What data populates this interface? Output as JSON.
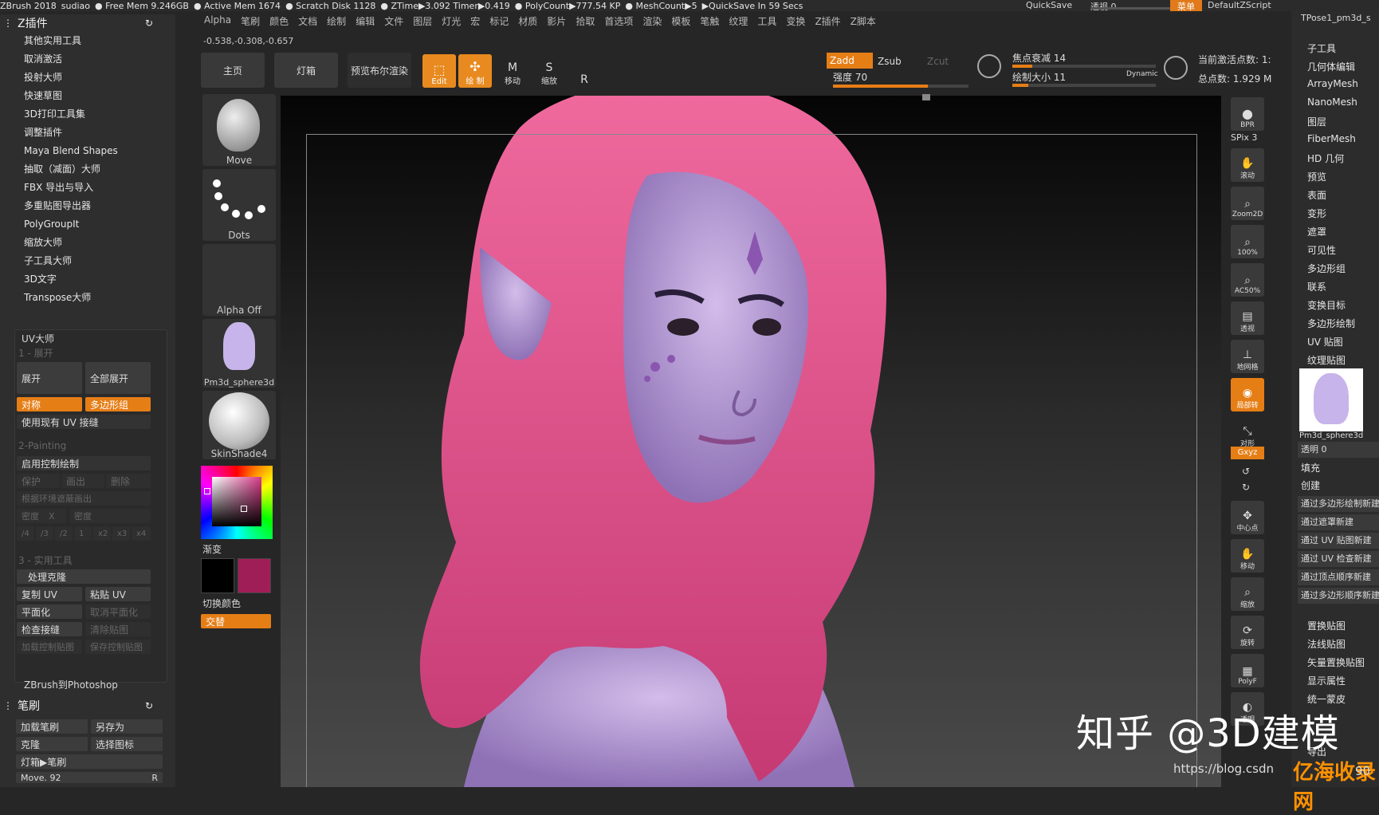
{
  "titlebar": {
    "items": [
      "ZBrush 2018",
      "sudiao",
      "● Free Mem 9.246GB",
      "● Active Mem 1674",
      "● Scratch Disk 1128",
      "● ZTime▶3.092 Timer▶0.419",
      "● PolyCount▶777.54 KP",
      "● MeshCount▶5",
      "▶QuickSave In 59 Secs"
    ],
    "quicksave": "QuickSave",
    "transparency": "透视  0",
    "menu": "菜单",
    "default_script": "DefaultZScript"
  },
  "menubar": [
    "Alpha",
    "笔刷",
    "颜色",
    "文档",
    "绘制",
    "编辑",
    "文件",
    "图层",
    "灯光",
    "宏",
    "标记",
    "材质",
    "影片",
    "拾取",
    "首选项",
    "渲染",
    "模板",
    "笔触",
    "纹理",
    "工具",
    "变换",
    "Z插件",
    "Z脚本"
  ],
  "coords": "-0.538,-0.308,-0.657",
  "left_panel": {
    "title": "Z插件",
    "items": [
      "其他实用工具",
      "取消激活",
      "投射大师",
      "快速草图",
      "3D打印工具集",
      "调整插件",
      "Maya Blend Shapes",
      "抽取（减面）大师",
      "FBX 导出与导入",
      "多重贴图导出器",
      "PolyGroupIt",
      "缩放大师",
      "子工具大师",
      "3D文字",
      "Transpose大师"
    ],
    "uv_master": "UV大师",
    "uv_step1": "1 - 展开",
    "unwrap": "展开",
    "unwrap_all": "全部展开",
    "symmetry": "对称",
    "polygroups": "多边形组",
    "use_existing_seams": "使用现有 UV 接缝",
    "step2": "2-Painting",
    "enable_control_painting": "启用控制绘制",
    "protect": "保护",
    "attract": "画出",
    "erase": "删除",
    "attract_from_ambient": "根据环境遮蔽画出",
    "density": "密度",
    "density_x": "X",
    "density2": "密度",
    "div4": "/4",
    "div3": "/3",
    "div2": "/2",
    "one": "1",
    "x2": "x2",
    "x3": "x3",
    "x4": "x4",
    "step3": "3 - 实用工具",
    "work_on_clone": "处理克隆",
    "copy_uvs": "复制 UV",
    "paste_uvs": "粘贴 UV",
    "flatten": "平面化",
    "unflatten": "取消平面化",
    "check_seams": "检查接缝",
    "clear_maps": "清除贴图",
    "load_control_map": "加载控制贴图",
    "save_control_map": "保存控制贴图",
    "zb_to_ps": "ZBrush到Photoshop",
    "brush_title": "笔刷",
    "load_brush": "加载笔刷",
    "save_as": "另存为",
    "clone": "克隆",
    "select_icon": "选择图标",
    "lightbox_brush": "灯箱▶笔刷",
    "move_value": "Move. 92",
    "r_label": "R"
  },
  "shelf": {
    "home": "主页",
    "lightbox": "灯箱",
    "bpr": "预览布尔渲染",
    "edit": "Edit",
    "draw": "绘 制",
    "move": "移动",
    "scale": "缩放",
    "rotate": "旋转",
    "zadd": "Zadd",
    "zsub": "Zsub",
    "zcut": "Zcut",
    "focal_shift": "焦点衰减 14",
    "draw_size": "绘制大小 11",
    "dynamic": "Dynamic",
    "intensity": "强度 70",
    "active_points": "当前激活点数: 1:",
    "total_points": "总点数: 1.929 M",
    "focal_shift_value": 14,
    "draw_size_value": 11,
    "intensity_value": 70
  },
  "tools": {
    "move": "Move",
    "dots": "Dots",
    "alpha_off": "Alpha Off",
    "pm3d": "Pm3d_sphere3d",
    "skinshade": "SkinShade4",
    "gradient": "渐变",
    "switch_color": "切换颜色",
    "alternate": "交替"
  },
  "rightcol": {
    "bpr": "BPR",
    "spix": "SPix 3",
    "scroll": "滚动",
    "zoom2d": "Zoom2D",
    "pct100": "100%",
    "ac50": "AC50%",
    "persp": "透视",
    "floor": "地网格",
    "local": "局部转",
    "frame": "对形",
    "xyz": "Gxyz",
    "center": "中心点",
    "moveR": "移动",
    "scaleR": "缩放",
    "rotateR": "旋转",
    "polyf": "PolyF",
    "transp": "透明"
  },
  "right_panel": {
    "tpose": "TPose1_pm3d_s",
    "items": [
      "子工具",
      "几何体编辑",
      "ArrayMesh",
      "NanoMesh",
      "图层",
      "FiberMesh",
      "HD 几何",
      "预览",
      "表面",
      "变形",
      "遮罩",
      "可见性",
      "多边形组",
      "联系",
      "变换目标",
      "多边形绘制",
      "UV 贴图",
      "纹理贴图"
    ],
    "texture_thumb": "Pm3d_sphere3d",
    "transp": "透明 0",
    "fill": "填充",
    "create": "创建",
    "subs": [
      "通过多边形绘制新建",
      "通过遮罩新建",
      "通过 UV 贴图新建",
      "通过 UV 检查新建",
      "通过顶点顺序新建",
      "通过多边形顺序新建"
    ],
    "items2": [
      "置换贴图",
      "法线贴图",
      "矢量置换贴图",
      "显示属性",
      "统一蒙皮"
    ],
    "export": "导出"
  },
  "watermark": {
    "main": "知乎 @3D建模",
    "url": "https://blog.csdn",
    "site": "亿海收录网",
    "suffix": "90"
  },
  "colors": {
    "accent": "#e67e16",
    "primary_swatch": "#000000",
    "secondary_swatch": "#a01e58",
    "hair": "#e0508a",
    "skin": "#b89ad6"
  }
}
